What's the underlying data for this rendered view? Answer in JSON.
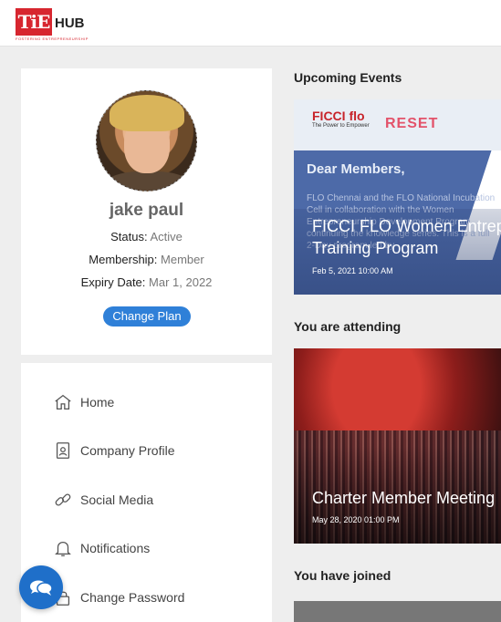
{
  "header": {
    "logo_text": "TiE",
    "logo_hub": "HUB",
    "logo_tagline": "FOSTERING ENTREPRENEURSHIP"
  },
  "profile": {
    "name": "jake paul",
    "status_label": "Status:",
    "status_value": "Active",
    "membership_label": "Membership:",
    "membership_value": "Member",
    "expiry_label": "Expiry Date:",
    "expiry_value": "Mar 1, 2022",
    "change_plan_label": "Change Plan"
  },
  "nav": {
    "items": [
      {
        "label": "Home",
        "icon": "home-icon"
      },
      {
        "label": "Company Profile",
        "icon": "id-card-icon"
      },
      {
        "label": "Social Media",
        "icon": "link-icon"
      },
      {
        "label": "Notifications",
        "icon": "bell-icon"
      },
      {
        "label": "Change Password",
        "icon": "lock-icon"
      }
    ]
  },
  "sections": {
    "upcoming": "Upcoming Events",
    "attending": "You are attending",
    "joined": "You have joined"
  },
  "events": {
    "upcoming": {
      "title": "FICCI FLO Women Entrep",
      "title2": "Training Program",
      "date": "Feb 5, 2021 10:00 AM",
      "img_ficci": "FICCI flo",
      "img_ficci_sub": "The Power to Empower",
      "img_reset": "RESET",
      "img_dear": "Dear Members,",
      "img_body": "FLO Chennai and the FLO National Incubation Cell in collaboration with the Women Entrepreneurship Development Program, continuing the knowledge series. This is a full 2-Day program led by"
    },
    "attending": {
      "title": "Charter Member Meeting",
      "date": "May 28, 2020 01:00 PM"
    }
  },
  "colors": {
    "accent": "#2f80d8",
    "brand_red": "#d7262f",
    "background": "#eeeeee"
  }
}
